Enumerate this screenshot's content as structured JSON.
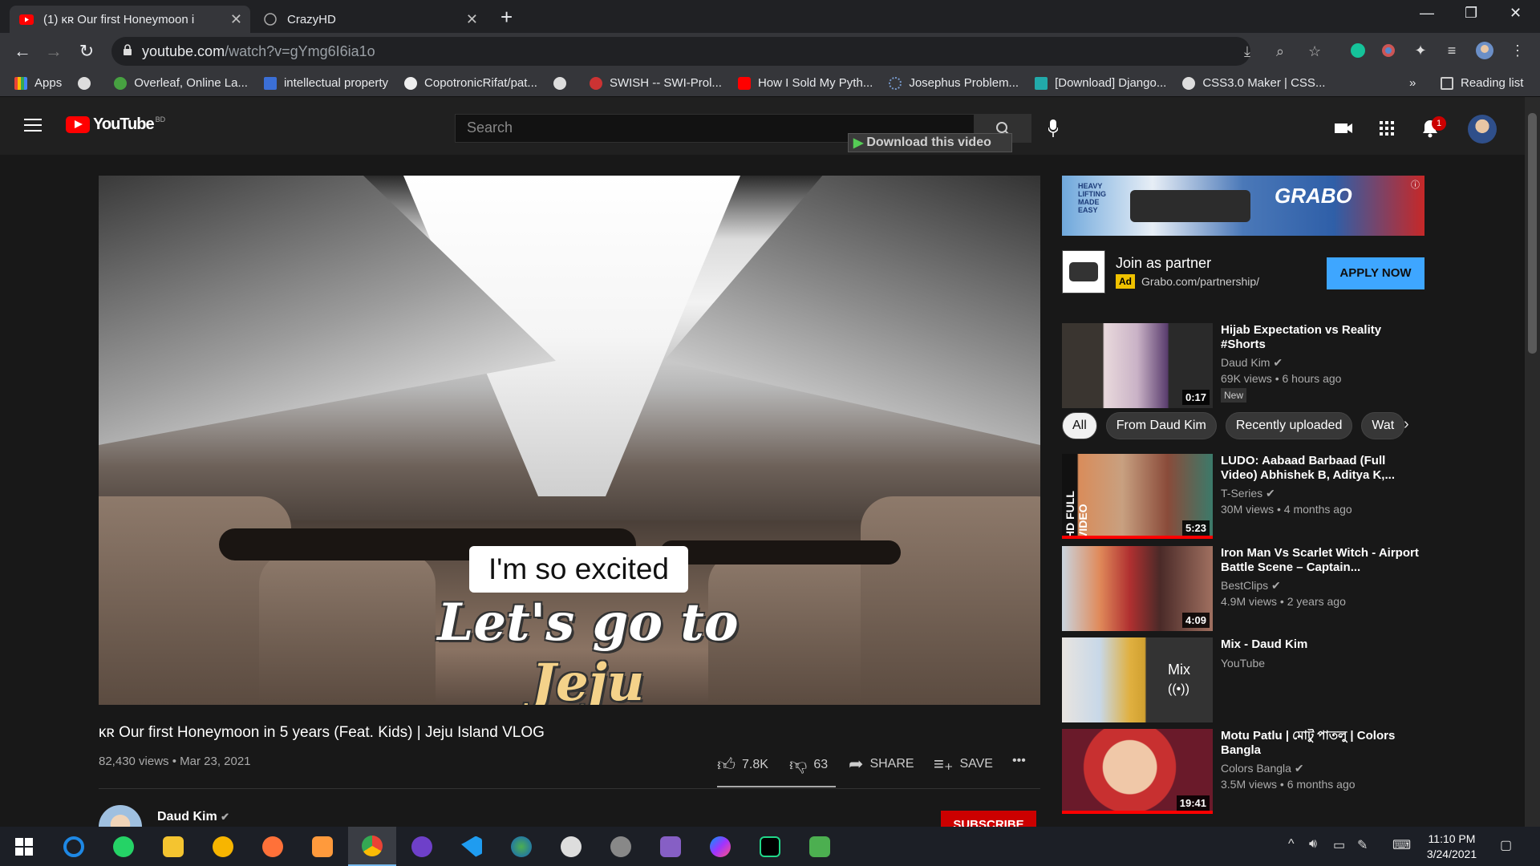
{
  "browser": {
    "tabs": [
      {
        "label": "(1) ᴋʀ Our first Honeymoon i",
        "active": true
      },
      {
        "label": "CrazyHD",
        "active": false
      }
    ],
    "url_domain": "youtube.com",
    "url_path": "/watch?v=gYmg6I6ia1o",
    "bookmarks": [
      "Apps",
      "",
      "Overleaf, Online La...",
      "intellectual property",
      "CopotronicRifat/pat...",
      "",
      "SWISH -- SWI-Prol...",
      "How I Sold My Pyth...",
      "Josephus Problem...",
      "[Download] Django...",
      "CSS3.0 Maker | CSS..."
    ],
    "bookmarks_overflow": "»",
    "reading_list": "Reading list"
  },
  "header": {
    "logo": "YouTube",
    "logo_region": "BD",
    "search_placeholder": "Search",
    "download_label": "Download this video",
    "notification_count": "1"
  },
  "video": {
    "subtitle_top": "I'm so excited",
    "subtitle_main_a": "Let's go to ",
    "subtitle_main_b": "Jeju",
    "title": "ᴋʀ Our first Honeymoon in 5 years (Feat. Kids) | Jeju Island VLOG",
    "views_date": "82,430 views • Mar 23, 2021",
    "likes": "7.8K",
    "dislikes": "63",
    "share": "SHARE",
    "save": "SAVE",
    "more": "•••",
    "channel": "Daud Kim",
    "subscribe": "SUBSCRIBE"
  },
  "ad": {
    "banner_brand": "GRABO",
    "banner_tag": "HEAVY LIFTING MADE EASY",
    "title": "Join as partner",
    "badge": "Ad",
    "url": "Grabo.com/partnership/",
    "cta": "APPLY NOW"
  },
  "chips": [
    "All",
    "From Daud Kim",
    "Recently uploaded",
    "Wat"
  ],
  "recommendations": [
    {
      "title": "Hijab Expectation vs Reality #Shorts",
      "channel": "Daud Kim",
      "meta": "69K views • 6 hours ago",
      "duration": "0:17",
      "badge": "New"
    },
    {
      "title": "LUDO: Aabaad Barbaad (Full Video) Abhishek B, Aditya K,...",
      "channel": "T-Series",
      "meta": "30M views • 4 months ago",
      "duration": "5:23"
    },
    {
      "title": "Iron Man Vs Scarlet Witch - Airport Battle Scene – Captain...",
      "channel": "BestClips",
      "meta": "4.9M views • 2 years ago",
      "duration": "4:09"
    },
    {
      "title": "Mix - Daud Kim",
      "channel": "YouTube",
      "meta": "",
      "duration": "",
      "mix_label": "Mix"
    },
    {
      "title": "Motu Patlu | মোটু পাতলু | Colors Bangla",
      "channel": "Colors Bangla",
      "meta": "3.5M views • 6 months ago",
      "duration": "19:41"
    }
  ],
  "taskbar": {
    "time": "11:10 PM",
    "date": "3/24/2021"
  },
  "colors": {
    "accent_red": "#cc0000",
    "apply_blue": "#3ea6ff",
    "page_bg": "#181818"
  }
}
